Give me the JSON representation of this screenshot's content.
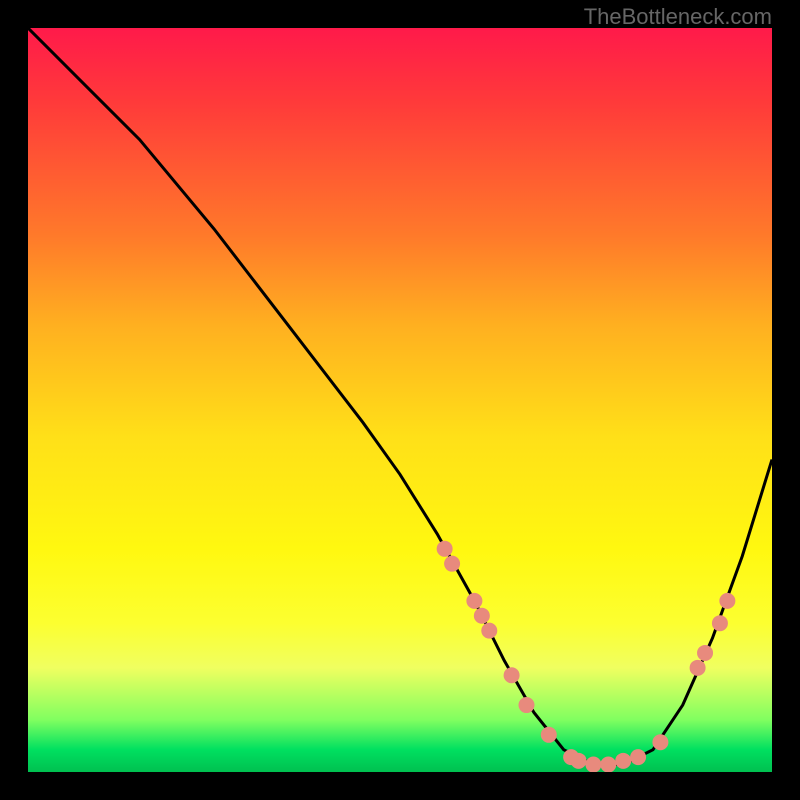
{
  "attribution": "TheBottleneck.com",
  "chart_data": {
    "type": "line",
    "title": "",
    "xlabel": "",
    "ylabel": "",
    "xlim": [
      0,
      100
    ],
    "ylim": [
      0,
      100
    ],
    "x": [
      0,
      3,
      8,
      15,
      25,
      35,
      45,
      50,
      55,
      60,
      64,
      68,
      72,
      76,
      80,
      84,
      88,
      92,
      96,
      100
    ],
    "values": [
      100,
      97,
      92,
      85,
      73,
      60,
      47,
      40,
      32,
      23,
      15,
      8,
      3,
      1,
      1,
      3,
      9,
      18,
      29,
      42
    ],
    "markers": [
      {
        "x": 56,
        "y": 30
      },
      {
        "x": 57,
        "y": 28
      },
      {
        "x": 60,
        "y": 23
      },
      {
        "x": 61,
        "y": 21
      },
      {
        "x": 62,
        "y": 19
      },
      {
        "x": 65,
        "y": 13
      },
      {
        "x": 67,
        "y": 9
      },
      {
        "x": 70,
        "y": 5
      },
      {
        "x": 73,
        "y": 2
      },
      {
        "x": 74,
        "y": 1.5
      },
      {
        "x": 76,
        "y": 1
      },
      {
        "x": 78,
        "y": 1
      },
      {
        "x": 80,
        "y": 1.5
      },
      {
        "x": 82,
        "y": 2
      },
      {
        "x": 85,
        "y": 4
      },
      {
        "x": 90,
        "y": 14
      },
      {
        "x": 91,
        "y": 16
      },
      {
        "x": 93,
        "y": 20
      },
      {
        "x": 94,
        "y": 23
      }
    ],
    "marker_color": "#e88a7d",
    "curve_color": "#000000",
    "gradient_stops": [
      {
        "pos": 0,
        "color": "#ff1a4a"
      },
      {
        "pos": 55,
        "color": "#ffe018"
      },
      {
        "pos": 100,
        "color": "#00c050"
      }
    ]
  }
}
